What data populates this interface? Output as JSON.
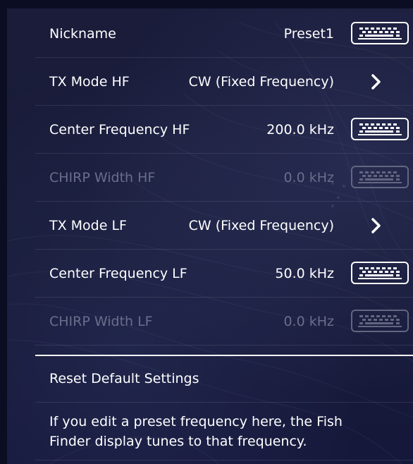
{
  "settings": {
    "rows": [
      {
        "label": "Nickname",
        "value": "Preset1",
        "control": "keyboard-icon",
        "disabled": false
      },
      {
        "label": "TX Mode HF",
        "value": "CW (Fixed Frequency)",
        "control": "chevron-right-icon",
        "disabled": false
      },
      {
        "label": "Center Frequency HF",
        "value": "200.0 kHz",
        "control": "keyboard-icon",
        "disabled": false
      },
      {
        "label": "CHIRP Width HF",
        "value": "0.0 kHz",
        "control": "keyboard-icon",
        "disabled": true
      },
      {
        "label": "TX Mode LF",
        "value": "CW (Fixed Frequency)",
        "control": "chevron-right-icon",
        "disabled": false
      },
      {
        "label": "Center Frequency LF",
        "value": "50.0 kHz",
        "control": "keyboard-icon",
        "disabled": false
      },
      {
        "label": "CHIRP Width LF",
        "value": "0.0 kHz",
        "control": "keyboard-icon",
        "disabled": true
      }
    ],
    "reset_label": "Reset Default Settings",
    "info_line1": "If you edit a preset frequency here, the Fish",
    "info_line2": "Finder display tunes to that frequency."
  },
  "colors": {
    "background": "#181b38",
    "text": "#ffffff",
    "disabled_text": "#6a6e8c"
  }
}
